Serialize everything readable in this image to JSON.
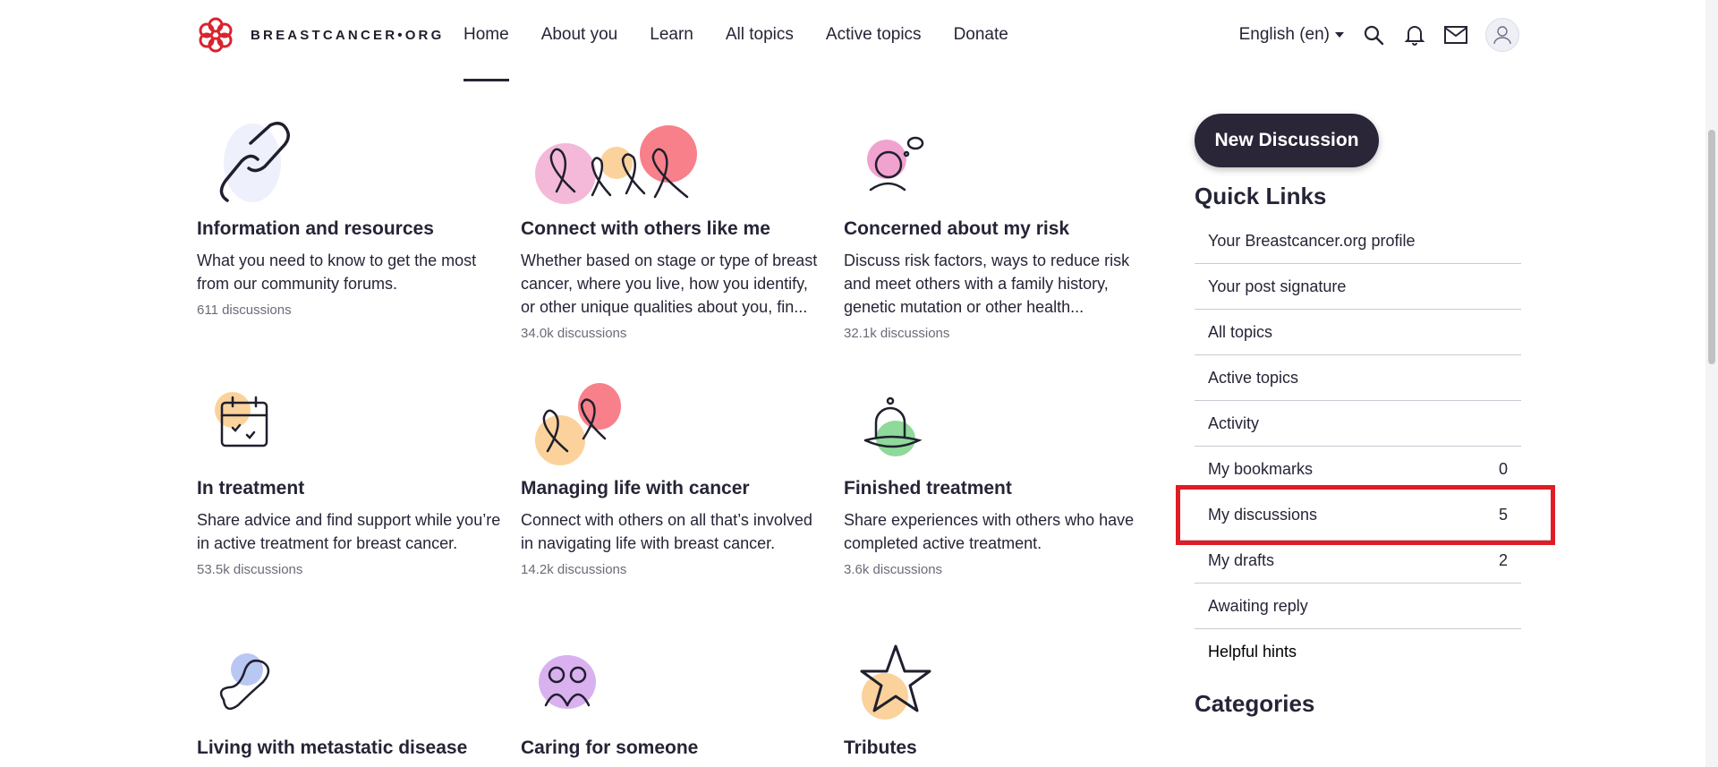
{
  "header": {
    "logo_text": "BREASTCANCER•ORG",
    "nav": [
      {
        "label": "Home"
      },
      {
        "label": "About you"
      },
      {
        "label": "Learn"
      },
      {
        "label": "All topics"
      },
      {
        "label": "Active topics"
      },
      {
        "label": "Donate"
      }
    ],
    "language": "English (en)"
  },
  "categories": [
    {
      "title": "Information and resources",
      "description": "What you need to know to get the most from our community forums.",
      "count": "611 discussions"
    },
    {
      "title": "Connect with others like me",
      "description": "Whether based on stage or type of breast cancer, where you live, how you identify, or other unique qualities about you, fin...",
      "count": "34.0k discussions"
    },
    {
      "title": "Concerned about my risk",
      "description": "Discuss risk factors, ways to reduce risk and meet others with a family history, genetic mutation or other health...",
      "count": "32.1k discussions"
    },
    {
      "title": "In treatment",
      "description": "Share advice and find support while you’re in active treatment for breast cancer.",
      "count": "53.5k discussions"
    },
    {
      "title": "Managing life with cancer",
      "description": "Connect with others on all that’s involved in navigating life with breast cancer.",
      "count": "14.2k discussions"
    },
    {
      "title": "Finished treatment",
      "description": "Share experiences with others who have completed active treatment.",
      "count": "3.6k discussions"
    },
    {
      "title": "Living with metastatic disease"
    },
    {
      "title": "Caring for someone"
    },
    {
      "title": "Tributes"
    }
  ],
  "sidebar": {
    "new_discussion": "New Discussion",
    "quick_links_title": "Quick Links",
    "quick_links": [
      {
        "label": "Your Breastcancer.org profile",
        "count": ""
      },
      {
        "label": "Your post signature",
        "count": ""
      },
      {
        "label": "All topics",
        "count": ""
      },
      {
        "label": "Active topics",
        "count": ""
      },
      {
        "label": "Activity",
        "count": ""
      },
      {
        "label": "My bookmarks",
        "count": "0"
      },
      {
        "label": "My discussions",
        "count": "5"
      },
      {
        "label": "My drafts",
        "count": "2"
      },
      {
        "label": "Awaiting reply",
        "count": ""
      },
      {
        "label": "Helpful hints",
        "count": ""
      }
    ],
    "categories_title": "Categories"
  },
  "colors": {
    "accent_red": "#e01c24",
    "button_dark": "#2a2638",
    "text": "#252537"
  }
}
